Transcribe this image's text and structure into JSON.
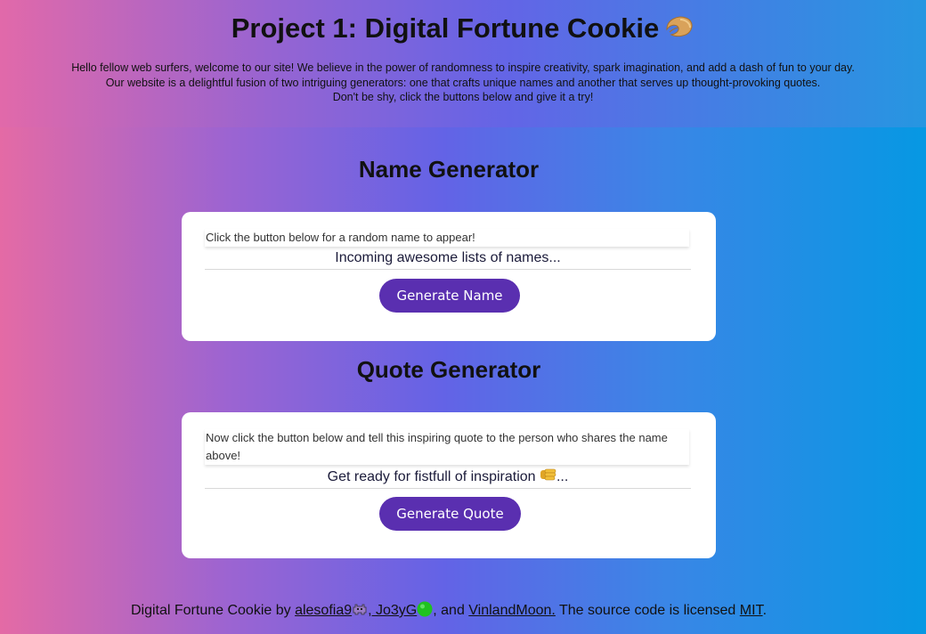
{
  "header": {
    "title": "Project 1: Digital Fortune Cookie",
    "title_icon": "fortune-cookie-icon",
    "intro_lines": [
      "Hello fellow web surfers, welcome to our site! We believe in the power of randomness to inspire creativity, spark imagination, and add a dash of fun to your day.",
      "Our website is a delightful fusion of two intriguing generators: one that crafts unique names and another that serves up thought-provoking quotes.",
      "Don't be shy, click the buttons below and give it a try!"
    ]
  },
  "name_generator": {
    "title": "Name Generator",
    "prompt": "Click the button below for a random name to appear!",
    "output": "Incoming awesome lists of names...",
    "button_label": "Generate Name"
  },
  "quote_generator": {
    "title": "Quote Generator",
    "prompt": "Now click the button below and tell this inspiring quote to the person who shares the name above!",
    "output_text": "Get ready for fistfull of inspiration ",
    "output_icon": "fist-icon",
    "output_suffix": "...",
    "button_label": "Generate Quote"
  },
  "footer": {
    "prefix": "Digital Fortune Cookie by ",
    "author1": "alesofia9",
    "author1_icon": "alien-monster-icon",
    "separator1": ", ",
    "author2": "Jo3yG",
    "author2_icon": "green-circle-icon",
    "separator2": ", and ",
    "author3": "VinlandMoon.",
    "license_text": " The source code is licensed ",
    "license_link": "MIT",
    "suffix": "."
  },
  "colors": {
    "button": "#5a2fb0",
    "card": "#ffffff",
    "gradient_left": "#e46aa5",
    "gradient_right": "#0698e3"
  }
}
